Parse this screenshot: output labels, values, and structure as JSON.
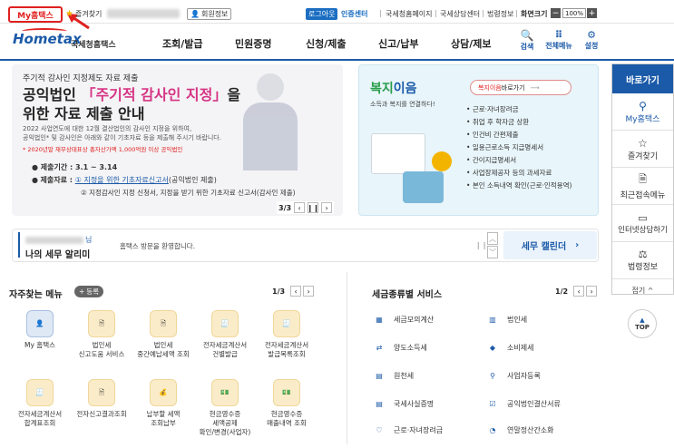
{
  "topbar": {
    "my_label": "My홈택스",
    "fav_label": "즐겨찾기",
    "member_label": "회원정보",
    "logout_label": "로그아웃",
    "cert_label": "인증센터",
    "links": [
      "국세청홈페이지",
      "국세상담센터",
      "법령정보",
      "화면크기"
    ],
    "zoom": "100%"
  },
  "nav": {
    "logo_text": "Hometax",
    "logo_sub": "국세청홈택스",
    "menus": [
      "조회/발급",
      "민원증명",
      "신청/제출",
      "신고/납부",
      "상담/제보"
    ],
    "icons": [
      "검색",
      "전체메뉴",
      "설정"
    ]
  },
  "banner1": {
    "kicker": "주기적 감사인 지정제도 자료 제출",
    "title_a": "공익법인 ",
    "title_hl": "「주기적 감사인 지정」",
    "title_b": "을",
    "title_c": "위한 자료 제출 안내",
    "desc1": "2022 사업연도에 대한 12월 결산법인의 감사인 지정을 위하여,",
    "desc2": "공익법인* 및 감사인은 아래와 같이 기초자료 등을 제출해 주시기 바랍니다.",
    "note": "* 2020년말 재무상태표상 총자산가액 1,000억원 이상 공익법인",
    "period_label": "제출기간 : 3.1 ~ 3.14",
    "data_label": "제출자료 : ",
    "data1": "① 지정을 위한 기초자료신고서",
    "data1_suffix": "(공익법인 제출)",
    "data2": "② 지정감사인 지정 신청서, 지정을 받기 위한 기초자료 신고서(감사인 제출)",
    "pager": "3/3"
  },
  "banner2": {
    "title_a": "복지",
    "title_b": "이음",
    "sub": "소득과 복지를 연결하다!",
    "go_hl": "복지이음",
    "go_rest": " 바로가기",
    "items": [
      "근로·자녀장려금",
      "취업 후 학자금 상환",
      "인건비 간편제출",
      "일용근로소득 지급명세서",
      "간이지급명세서",
      "사업장제공자 등의 과세자료",
      "본인 소득내역 확인(근로·인적용역)"
    ]
  },
  "rightbar": {
    "title": "바로가기",
    "items": [
      "My홈택스",
      "즐겨찾기",
      "최근접속메뉴",
      "인터넷상담하기",
      "법령정보"
    ],
    "fold": "접기",
    "top": "TOP"
  },
  "notice": {
    "suffix": "님",
    "title": "나의 세무 알리미",
    "welcome": "홈택스 방문을 환영합니다.",
    "calendar": "세무 캘린더"
  },
  "fav": {
    "title": "자주찾는 메뉴",
    "add": "등록",
    "pager": "1/3",
    "items": [
      "My 홈택스",
      "법인세\n신고도움 서비스",
      "법인세\n중간예납세액 조회",
      "전자세금계산서\n건별발급",
      "전자세금계산서\n발급목록조회",
      "전자세금계산서\n합계표조회",
      "전자신고결과조회",
      "납부할 세액\n조회납부",
      "현금영수증\n세액공제\n확인/변경(사업자)",
      "현금영수증\n매출내역 조회"
    ]
  },
  "taxsvc": {
    "title": "세금종류별 서비스",
    "pager": "1/2",
    "items": [
      "세금모의계산",
      "법인세",
      "양도소득세",
      "소비제세",
      "원천세",
      "사업자등록",
      "국세사실증명",
      "공익법인결산서류",
      "근로·자녀장려금",
      "연말정산간소화"
    ]
  },
  "colors": {
    "brand": "#1b5aa8",
    "accent": "#e02020",
    "highlight": "#d63384"
  }
}
